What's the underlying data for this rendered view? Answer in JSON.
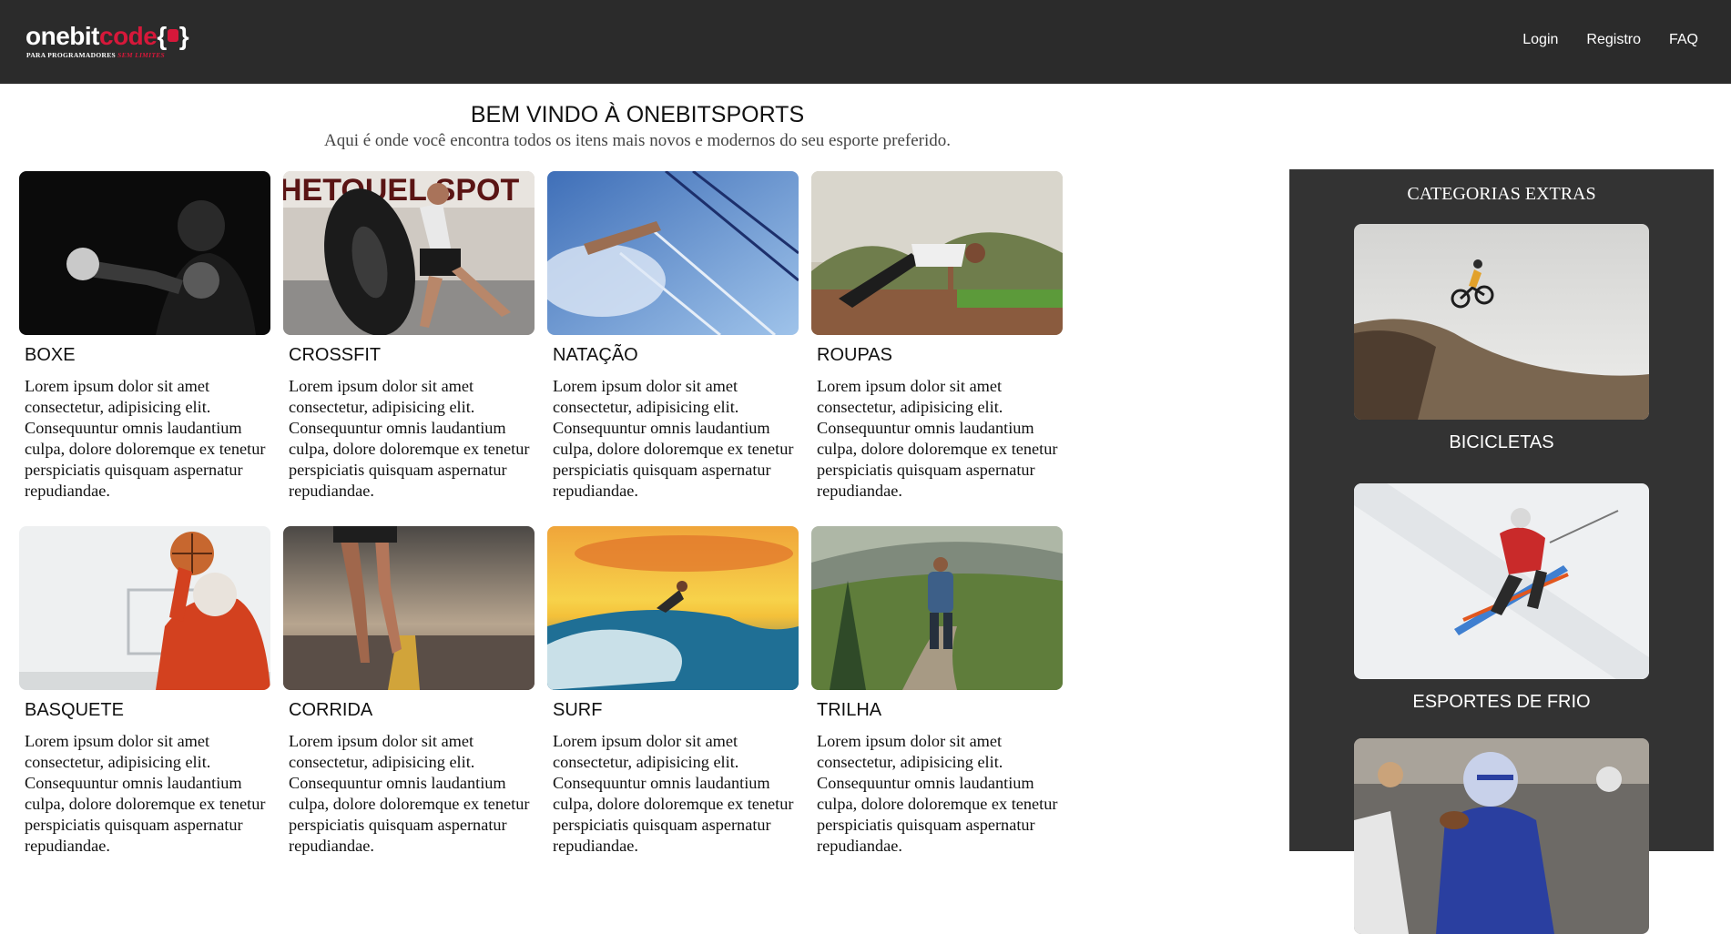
{
  "header": {
    "logo": {
      "word_light": "onebit",
      "word_accent": "code",
      "brace_open": "{",
      "brace_close": "}",
      "tag_light": "PARA PROGRAMADORES",
      "tag_accent": "SEM LIMITES"
    },
    "nav": [
      {
        "label": "Login"
      },
      {
        "label": "Registro"
      },
      {
        "label": "FAQ"
      }
    ],
    "colors": {
      "background": "#2b2b2b",
      "accent": "#d6183a"
    }
  },
  "hero": {
    "title": "BEM VINDO À ONEBITSPORTS",
    "subtitle": "Aqui é onde você encontra todos os itens mais novos e modernos do seu esporte preferido."
  },
  "cards": [
    {
      "title": "BOXE",
      "text": "Lorem ipsum dolor sit amet consectetur, adipisicing elit. Consequuntur omnis laudantium culpa, dolore doloremque ex tenetur perspiciatis quisquam aspernatur repudiandae.",
      "image": "boxer-photo"
    },
    {
      "title": "CROSSFIT",
      "text": "Lorem ipsum dolor sit amet consectetur, adipisicing elit. Consequuntur omnis laudantium culpa, dolore doloremque ex tenetur perspiciatis quisquam aspernatur repudiandae.",
      "image": "tire-flip-photo"
    },
    {
      "title": "NATAÇÃO",
      "text": "Lorem ipsum dolor sit amet consectetur, adipisicing elit. Consequuntur omnis laudantium culpa, dolore doloremque ex tenetur perspiciatis quisquam aspernatur repudiandae.",
      "image": "swimmer-photo"
    },
    {
      "title": "ROUPAS",
      "text": "Lorem ipsum dolor sit amet consectetur, adipisicing elit. Consequuntur omnis laudantium culpa, dolore doloremque ex tenetur perspiciatis quisquam aspernatur repudiandae.",
      "image": "pushup-photo"
    },
    {
      "title": "BASQUETE",
      "text": "Lorem ipsum dolor sit amet consectetur, adipisicing elit. Consequuntur omnis laudantium culpa, dolore doloremque ex tenetur perspiciatis quisquam aspernatur repudiandae.",
      "image": "basketball-photo"
    },
    {
      "title": "CORRIDA",
      "text": "Lorem ipsum dolor sit amet consectetur, adipisicing elit. Consequuntur omnis laudantium culpa, dolore doloremque ex tenetur perspiciatis quisquam aspernatur repudiandae.",
      "image": "runner-road-photo"
    },
    {
      "title": "SURF",
      "text": "Lorem ipsum dolor sit amet consectetur, adipisicing elit. Consequuntur omnis laudantium culpa, dolore doloremque ex tenetur perspiciatis quisquam aspernatur repudiandae.",
      "image": "surfer-sunset-photo"
    },
    {
      "title": "TRILHA",
      "text": "Lorem ipsum dolor sit amet consectetur, adipisicing elit. Consequuntur omnis laudantium culpa, dolore doloremque ex tenetur perspiciatis quisquam aspernatur repudiandae.",
      "image": "hiker-photo"
    }
  ],
  "sidebar": {
    "title": "CATEGORIAS EXTRAS",
    "items": [
      {
        "label": "BICICLETAS",
        "image": "mountain-bike-jump-photo"
      },
      {
        "label": "ESPORTES DE FRIO",
        "image": "skier-photo"
      },
      {
        "label": "",
        "image": "american-football-photo"
      }
    ],
    "colors": {
      "background": "#333333"
    }
  }
}
